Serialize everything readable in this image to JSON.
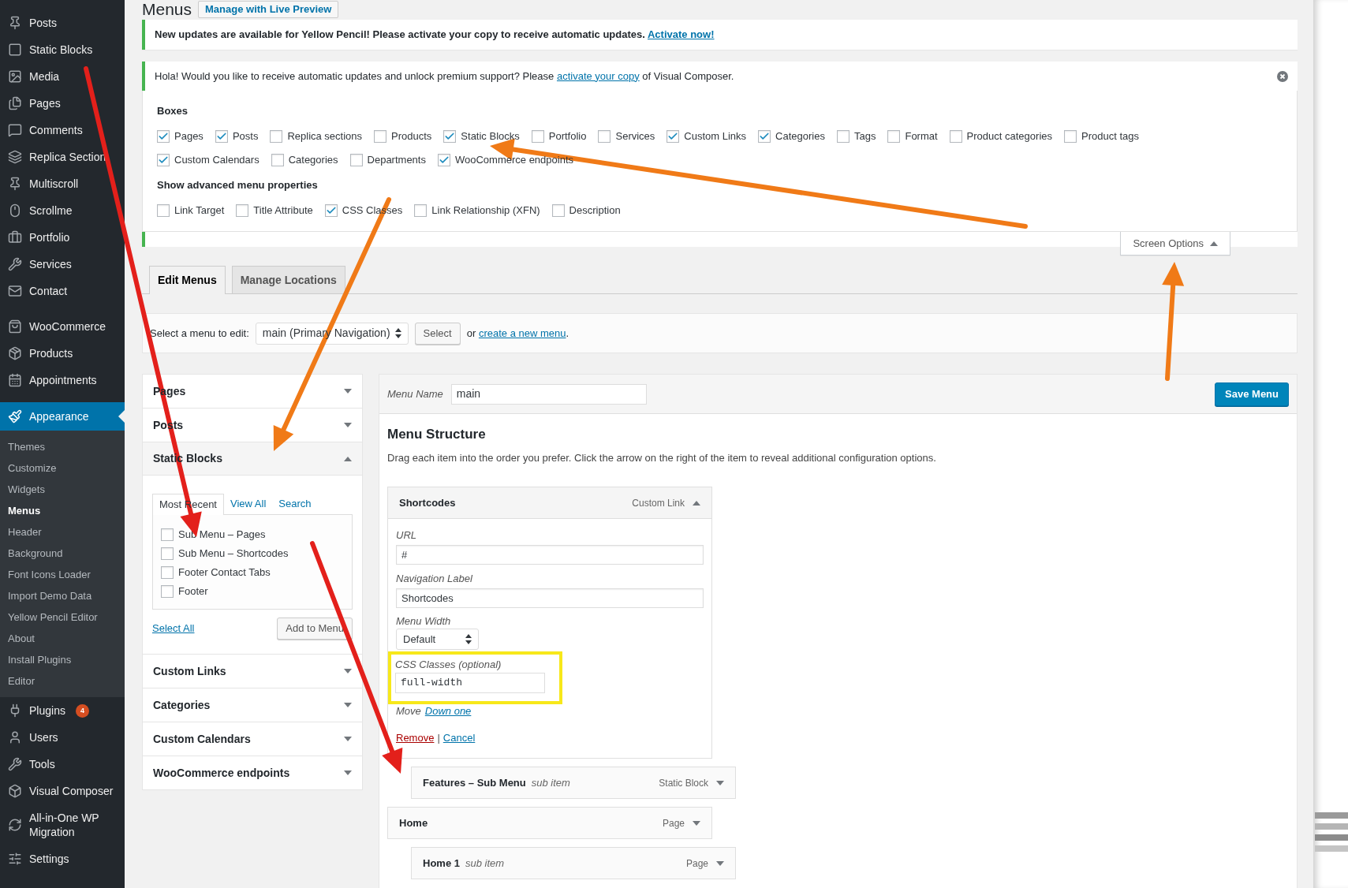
{
  "page": {
    "title": "Menus",
    "live_preview_button": "Manage with Live Preview"
  },
  "sidebar": {
    "groups": [
      {
        "items": [
          {
            "label": "Posts",
            "selected": false
          },
          {
            "label": "Static Blocks",
            "selected": false
          },
          {
            "label": "Media",
            "selected": false
          },
          {
            "label": "Pages",
            "selected": false
          },
          {
            "label": "Comments",
            "selected": false
          },
          {
            "label": "Replica Section",
            "selected": false
          },
          {
            "label": "Multiscroll",
            "selected": false
          },
          {
            "label": "Scrollme",
            "selected": false
          },
          {
            "label": "Portfolio",
            "selected": false
          },
          {
            "label": "Services",
            "selected": false
          },
          {
            "label": "Contact",
            "selected": false
          }
        ]
      },
      {
        "items": [
          {
            "label": "WooCommerce",
            "selected": false
          },
          {
            "label": "Products",
            "selected": false
          },
          {
            "label": "Appointments",
            "selected": false
          }
        ]
      },
      {
        "items": [
          {
            "label": "Appearance",
            "selected": true,
            "children": [
              {
                "label": "Themes",
                "selected": false
              },
              {
                "label": "Customize",
                "selected": false
              },
              {
                "label": "Widgets",
                "selected": false
              },
              {
                "label": "Menus",
                "selected": true
              },
              {
                "label": "Header",
                "selected": false
              },
              {
                "label": "Background",
                "selected": false
              },
              {
                "label": "Font Icons Loader",
                "selected": false
              },
              {
                "label": "Import Demo Data",
                "selected": false
              },
              {
                "label": "Yellow Pencil Editor",
                "selected": false
              },
              {
                "label": "About",
                "selected": false
              },
              {
                "label": "Install Plugins",
                "selected": false
              },
              {
                "label": "Editor",
                "selected": false
              }
            ]
          },
          {
            "label": "Plugins",
            "selected": false,
            "badge": "4"
          },
          {
            "label": "Users",
            "selected": false
          },
          {
            "label": "Tools",
            "selected": false
          },
          {
            "label": "Visual Composer",
            "selected": false
          },
          {
            "label": "All-in-One WP Migration",
            "selected": false
          },
          {
            "label": "Settings",
            "selected": false
          }
        ]
      }
    ]
  },
  "notices": [
    {
      "text": "New updates are available for Yellow Pencil! Please activate your copy to receive automatic updates.",
      "link": "Activate now!"
    },
    {
      "text": "Hola! Would you like to receive automatic updates and unlock premium support? Please",
      "link": "activate your copy",
      "after": "of Visual Composer."
    }
  ],
  "screen_options": {
    "toggle": "Screen Options",
    "expanded": true,
    "boxes_title": "Boxes",
    "boxes": [
      {
        "label": "Pages",
        "checked": true
      },
      {
        "label": "Posts",
        "checked": true
      },
      {
        "label": "Replica sections",
        "checked": false
      },
      {
        "label": "Products",
        "checked": false
      },
      {
        "label": "Static Blocks",
        "checked": true
      },
      {
        "label": "Portfolio",
        "checked": false
      },
      {
        "label": "Services",
        "checked": false
      },
      {
        "label": "Custom Links",
        "checked": true
      },
      {
        "label": "Categories",
        "checked": true
      },
      {
        "label": "Tags",
        "checked": false
      },
      {
        "label": "Format",
        "checked": false
      },
      {
        "label": "Product categories",
        "checked": false
      },
      {
        "label": "Product tags",
        "checked": false
      },
      {
        "label": "Custom Calendars",
        "checked": true
      },
      {
        "label": "Categories",
        "checked": false
      },
      {
        "label": "Departments",
        "checked": false
      },
      {
        "label": "WooCommerce endpoints",
        "checked": true
      }
    ],
    "advanced_title": "Show advanced menu properties",
    "advanced": [
      {
        "label": "Link Target",
        "checked": false
      },
      {
        "label": "Title Attribute",
        "checked": false
      },
      {
        "label": "CSS Classes",
        "checked": true
      },
      {
        "label": "Link Relationship (XFN)",
        "checked": false
      },
      {
        "label": "Description",
        "checked": false
      }
    ]
  },
  "tabs": [
    {
      "label": "Edit Menus",
      "selected": true
    },
    {
      "label": "Manage Locations",
      "selected": false
    }
  ],
  "select_bar": {
    "label": "Select a menu to edit:",
    "value": "main (Primary Navigation)",
    "button": "Select",
    "or": "or",
    "link": "create a new menu",
    "after": "."
  },
  "add_panels": [
    {
      "title": "Pages",
      "expanded": false
    },
    {
      "title": "Posts",
      "expanded": false
    },
    {
      "title": "Static Blocks",
      "expanded": true,
      "tabs": [
        {
          "label": "Most Recent",
          "selected": true
        },
        {
          "label": "View All",
          "selected": false
        },
        {
          "label": "Search",
          "selected": false
        }
      ],
      "items": [
        {
          "label": "Sub Menu – Pages",
          "checked": false
        },
        {
          "label": "Sub Menu – Shortcodes",
          "checked": false
        },
        {
          "label": "Footer Contact Tabs",
          "checked": false
        },
        {
          "label": "Footer",
          "checked": false
        }
      ],
      "select_all": "Select All",
      "add_button": "Add to Menu"
    },
    {
      "title": "Custom Links",
      "expanded": false
    },
    {
      "title": "Categories",
      "expanded": false
    },
    {
      "title": "Custom Calendars",
      "expanded": false
    },
    {
      "title": "WooCommerce endpoints",
      "expanded": false
    }
  ],
  "menu_editor": {
    "name_label": "Menu Name",
    "name_value": "main",
    "save_button": "Save Menu",
    "heading": "Menu Structure",
    "description": "Drag each item into the order you prefer. Click the arrow on the right of the item to reveal additional configuration options.",
    "items": [
      {
        "title": "Shortcodes",
        "type": "Custom Link",
        "expanded": true,
        "settings": {
          "url_label": "URL",
          "url": "#",
          "nav_label_label": "Navigation Label",
          "nav_label": "Shortcodes",
          "width_label": "Menu Width",
          "width_value": "Default",
          "css_label": "CSS Classes (optional)",
          "css_value": "full-width",
          "move_label": "Move",
          "move_link": "Down one",
          "remove": "Remove",
          "separator": "|",
          "cancel": "Cancel"
        },
        "children": [
          {
            "title": "Features – Sub Menu",
            "sub_label": "sub item",
            "type": "Static Block",
            "expanded": false
          }
        ]
      },
      {
        "title": "Home",
        "type": "Page",
        "expanded": false,
        "children": [
          {
            "title": "Home 1",
            "sub_label": "sub item",
            "type": "Page",
            "expanded": false
          }
        ]
      }
    ]
  },
  "annotations": [
    {
      "kind": "arrow",
      "color": "#e3201b"
    },
    {
      "kind": "arrow",
      "color": "#e3201b"
    },
    {
      "kind": "arrow",
      "color": "#f07a17"
    },
    {
      "kind": "arrow",
      "color": "#f07a17"
    },
    {
      "kind": "arrow",
      "color": "#f07a17"
    },
    {
      "kind": "highlight",
      "color": "#f7e81a"
    }
  ]
}
